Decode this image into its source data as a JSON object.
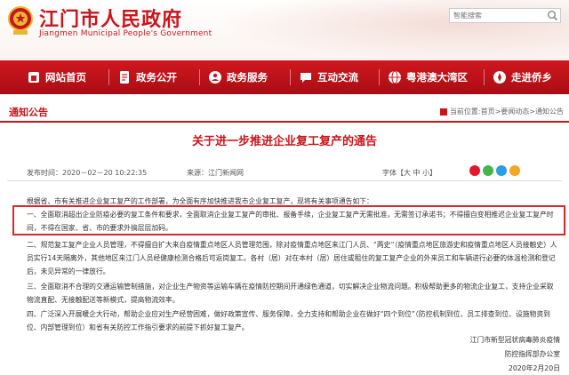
{
  "header": {
    "site_title": "江门市人民政府",
    "site_subtitle": "Jiangmen Municipal People's Government",
    "search_placeholder": "智能搜索",
    "emblem_icon": "national-emblem-icon",
    "search_icon": "search-icon",
    "brand_color": "#c8161d"
  },
  "nav": {
    "items": [
      {
        "label": "网站首页",
        "icon": "home-icon"
      },
      {
        "label": "政务公开",
        "icon": "document-icon"
      },
      {
        "label": "政务服务",
        "icon": "service-icon"
      },
      {
        "label": "互动交流",
        "icon": "chat-icon"
      },
      {
        "label": "粤港澳大湾区",
        "icon": "globe-icon"
      },
      {
        "label": "走进侨乡",
        "icon": "compass-icon"
      }
    ]
  },
  "breadcrumb": {
    "section_title": "通知公告",
    "prefix": "当前位置:",
    "items": [
      "首页",
      "要闻动态",
      "通知公告"
    ],
    "separator": " > "
  },
  "article": {
    "title": "关于进一步推进企业复工复产的通告",
    "date": "发布时间：2020－02－20 10:22:35",
    "source": "来源：江门新闻网",
    "font_size_label": "字体【大 中 小】",
    "intro": "根据省、市有关推进企业复工复产的工作部署，为全面有序加快推进我市企业复工复产，现将有关事项通告如下：",
    "item1": "一、全面取消超出企业防疫必要的复工条件和要求，全面取消企业复工复产的审批、报备手续，企业复工复产无需批准，无需签订承诺书；不得擅自变相推迟企业复工复产时间，不得在国家、省、市的要求外搞层层加码。",
    "item2": "二、规范复工复产企业人员管理，不得擅自扩大来自疫情重点地区人员管理范围，除对疫情重点地区来江门人员、“两史”（疫情重点地区旅游史和疫情重点地区人员接触史）人员实行14天隔离外，其他地区来江门人员经健康检测合格后可返岗复工。各村（居）对在本村（居）居住或租住的复工复产企业的外来员工和车辆进行必要的体温检测和登记后，未见异常的一律放行。",
    "item3": "三、全面取消不合理的交通运输管制措施，对企业生产物资等运输车辆在疫情防控期间开通绿色通道，切实解决企业物流问题。积极帮助更多的物流企业复工，支持企业采取物流直配、无接触配送等新模式，提高物流效率。",
    "item4": "四、广泛深入开展暖企大行动，帮助企业应对生产经营困难，做好政策宣传、服务保障，全力支持和帮助企业在做好“四个到位”（防控机制到位、员工排查到位、设施物资到位、内部管理到位）和省有关防控工作指引要求的前提下抓好复工复产。",
    "signature_1": "江门市新型冠状病毒肺炎疫情",
    "signature_2": "防控指挥部办公室",
    "signature_date": "2020年2月20日",
    "highlight_color": "#d8282c"
  }
}
